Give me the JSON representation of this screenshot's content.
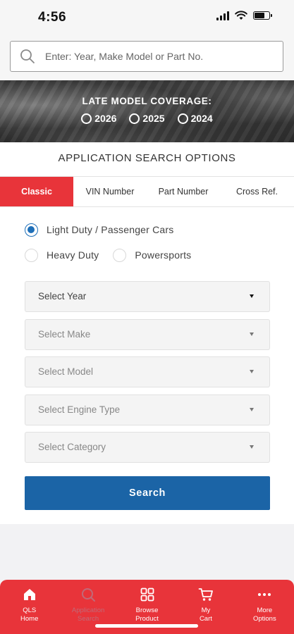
{
  "status_bar": {
    "time": "4:56"
  },
  "search": {
    "placeholder": "Enter: Year, Make Model or Part No."
  },
  "banner": {
    "title": "LATE MODEL COVERAGE:",
    "years": [
      "2026",
      "2025",
      "2024"
    ]
  },
  "main": {
    "section_title": "APPLICATION SEARCH OPTIONS",
    "tabs": [
      {
        "label": "Classic",
        "active": true
      },
      {
        "label": "VIN Number"
      },
      {
        "label": "Part Number"
      },
      {
        "label": "Cross Ref."
      }
    ],
    "vehicle_types": [
      {
        "label": "Light Duty / Passenger Cars",
        "selected": true
      },
      {
        "label": "Heavy Duty"
      },
      {
        "label": "Powersports"
      }
    ],
    "selects": [
      {
        "label": "Select Year",
        "enabled": true
      },
      {
        "label": "Select Make"
      },
      {
        "label": "Select Model"
      },
      {
        "label": "Select Engine Type"
      },
      {
        "label": "Select Category"
      }
    ],
    "search_button": "Search"
  },
  "bottom_nav": [
    {
      "label": "QLS\nHome",
      "icon": "home-icon"
    },
    {
      "label": "Application\nSearch",
      "icon": "search-icon",
      "active": true
    },
    {
      "label": "Browse\nProduct",
      "icon": "grid-icon"
    },
    {
      "label": "My\nCart",
      "icon": "cart-icon"
    },
    {
      "label": "More\nOptions",
      "icon": "more-icon"
    }
  ],
  "colors": {
    "accent_red": "#e8343a",
    "primary_blue": "#1b64a6",
    "radio_blue": "#1e6fb8"
  }
}
